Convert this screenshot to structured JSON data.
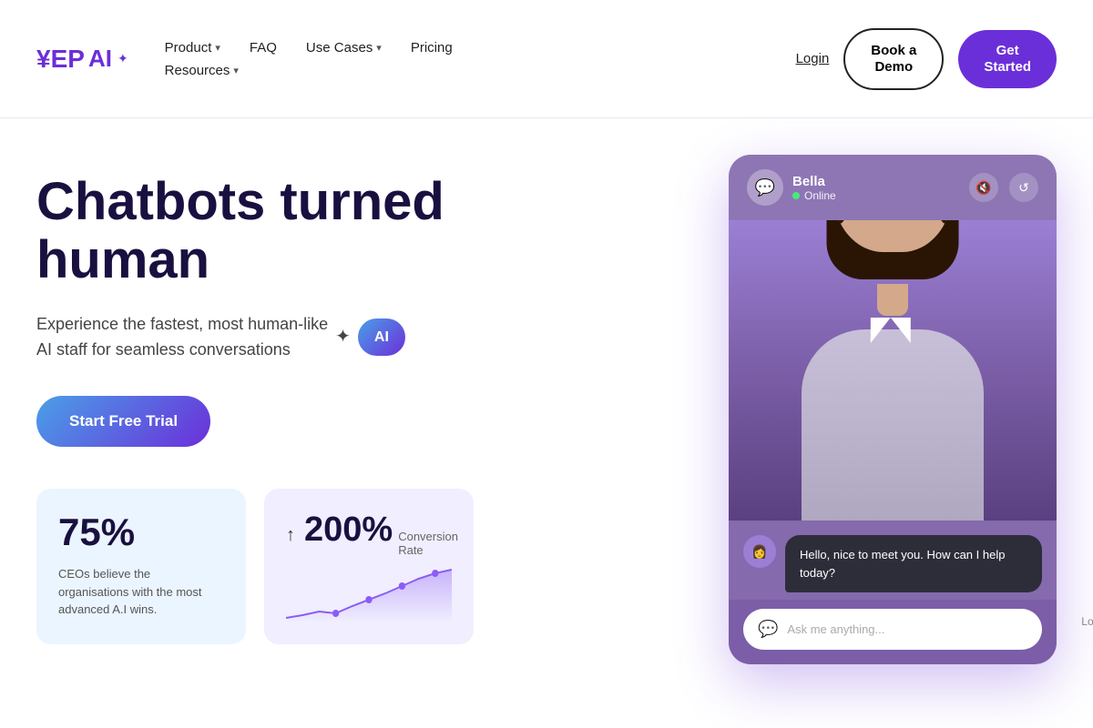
{
  "nav": {
    "logo_ep": "EP",
    "logo_prefix": "¥",
    "logo_full": "YEPAI",
    "items_row1": [
      {
        "label": "Product",
        "has_chevron": true
      },
      {
        "label": "FAQ",
        "has_chevron": false
      },
      {
        "label": "Use Cases",
        "has_chevron": true
      },
      {
        "label": "Pricing",
        "has_chevron": false
      }
    ],
    "items_row2": [
      {
        "label": "Resources",
        "has_chevron": true
      }
    ],
    "login": "Login",
    "book_demo": "Book a\nDemo",
    "get_started": "Get\nStarted"
  },
  "hero": {
    "title_line1": "Chatbots turned",
    "title_line2": "human",
    "subtitle": "Experience the fastest, most human-like\nAI staff for seamless conversations",
    "ai_badge": "AI",
    "cta": "Start Free Trial"
  },
  "stats": [
    {
      "number": "75%",
      "description": "CEOs believe the organisations with the most advanced A.I wins."
    },
    {
      "arrow": "↑",
      "number": "200%",
      "label": "Conversion Rate"
    }
  ],
  "chatbot": {
    "name": "Bella",
    "status": "Online",
    "message": "Hello, nice to meet you. How can I help today?",
    "input_placeholder": "Ask me anything...",
    "loading_text": "Loading..."
  }
}
